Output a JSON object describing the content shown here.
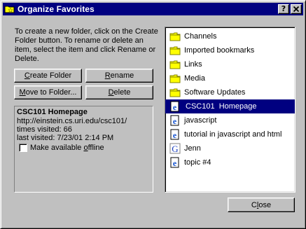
{
  "window": {
    "title": "Organize Favorites",
    "help_button": "?",
    "close_button": "X"
  },
  "intro_text": "To create a new folder, click on the Create Folder button. To rename or delete an item, select the item and click Rename or Delete.",
  "buttons": {
    "create_folder": {
      "pre": "",
      "u": "C",
      "post": "reate Folder"
    },
    "rename": {
      "pre": "",
      "u": "R",
      "post": "ename"
    },
    "move_to_folder": {
      "pre": "",
      "u": "M",
      "post": "ove to Folder..."
    },
    "delete": {
      "pre": "",
      "u": "D",
      "post": "elete"
    },
    "close": {
      "pre": "C",
      "u": "l",
      "post": "ose"
    }
  },
  "info": {
    "name": "CSC101 Homepage",
    "url": "http://einstein.cs.uri.edu/csc101/",
    "times_visited": "times visited: 66",
    "last_visited": "last visited: 7/23/01 2:14 PM",
    "offline_pre": "Make available ",
    "offline_u": "o",
    "offline_post": "ffline"
  },
  "favorites": [
    {
      "label": "Channels",
      "icon": "folder-icon"
    },
    {
      "label": "Imported bookmarks",
      "icon": "folder-icon"
    },
    {
      "label": "Links",
      "icon": "folder-icon"
    },
    {
      "label": "Media",
      "icon": "folder-icon"
    },
    {
      "label": "Software Updates",
      "icon": "folder-icon"
    },
    {
      "label": "CSC101  Homepage",
      "icon": "ie-page-icon",
      "selected": true
    },
    {
      "label": "javascript",
      "icon": "ie-page-icon"
    },
    {
      "label": "tutorial in javascript and html",
      "icon": "ie-page-icon"
    },
    {
      "label": "Jenn",
      "icon": "google-g-icon"
    },
    {
      "label": "topic #4",
      "icon": "ie-page-icon"
    }
  ],
  "colors": {
    "face": "#c0c0c0",
    "titlebar": "#000080",
    "selection": "#000080",
    "folder": "#ffff00"
  }
}
